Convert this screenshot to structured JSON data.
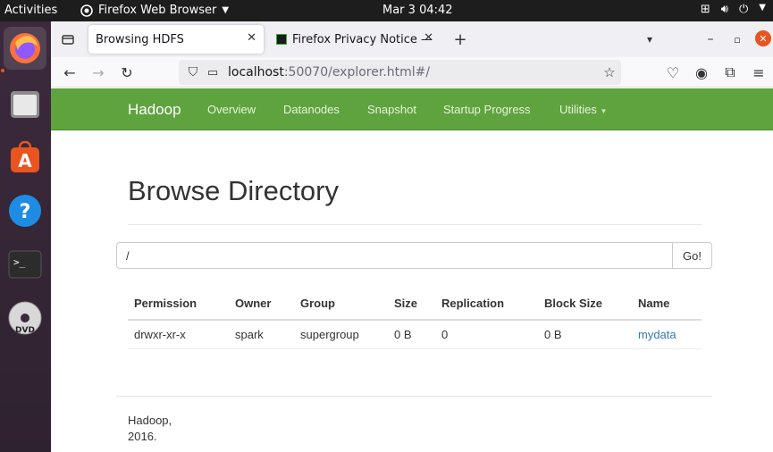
{
  "topbar": {
    "activities": "Activities",
    "app_name": "Firefox Web Browser",
    "clock": "Mar 3  04:42"
  },
  "dock": {
    "items": [
      "firefox-icon",
      "files-icon",
      "app-center-icon",
      "help-icon",
      "terminal-icon",
      "dvd-icon"
    ]
  },
  "browser": {
    "tabs": [
      {
        "label": "Browsing HDFS",
        "active": true
      },
      {
        "label": "Firefox Privacy Notice —",
        "active": false
      }
    ],
    "url": {
      "host": "localhost",
      "rest": ":50070/explorer.html#/"
    }
  },
  "hadoop_nav": {
    "brand": "Hadoop",
    "links": [
      "Overview",
      "Datanodes",
      "Snapshot",
      "Startup Progress",
      "Utilities"
    ]
  },
  "page": {
    "title": "Browse Directory",
    "path_value": "/",
    "go_label": "Go!",
    "table": {
      "headers": [
        "Permission",
        "Owner",
        "Group",
        "Size",
        "Replication",
        "Block Size",
        "Name"
      ],
      "rows": [
        [
          "drwxr-xr-x",
          "spark",
          "supergroup",
          "0 B",
          "0",
          "0 B",
          "mydata"
        ]
      ]
    },
    "footer_line1": "Hadoop,",
    "footer_line2": "2016."
  },
  "colors": {
    "hadoop_green": "#5fa33e",
    "link_blue": "#337ab7",
    "ubuntu_orange": "#e95420"
  }
}
